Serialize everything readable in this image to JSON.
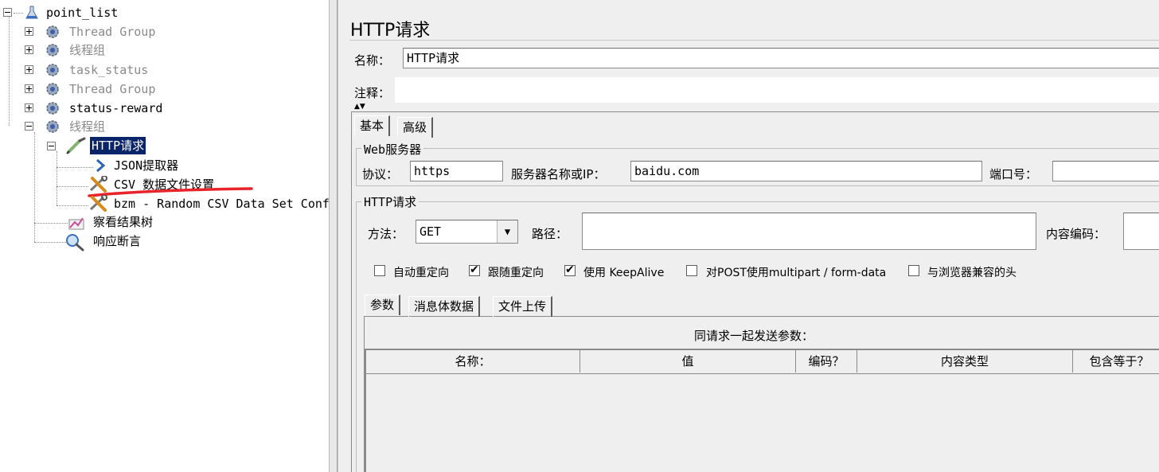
{
  "tree": {
    "root": "point_list",
    "groups": [
      {
        "label": "Thread Group",
        "enabled": false
      },
      {
        "label": "线程组",
        "enabled": false
      },
      {
        "label": "task_status",
        "enabled": false
      },
      {
        "label": "Thread Group",
        "enabled": false
      },
      {
        "label": "status-reward",
        "enabled": true
      },
      {
        "label": "线程组",
        "enabled": false
      }
    ],
    "sampler": "HTTP请求",
    "children": [
      {
        "label": "JSON提取器",
        "icon": "arrow-icon"
      },
      {
        "label": "CSV 数据文件设置",
        "icon": "tools-icon"
      },
      {
        "label": "bzm - Random CSV Data Set Config",
        "icon": "tools-icon"
      }
    ],
    "listeners": [
      {
        "label": "察看结果树",
        "icon": "graph-icon"
      },
      {
        "label": "响应断言",
        "icon": "magnifier-icon"
      }
    ]
  },
  "panel": {
    "title": "HTTP请求",
    "name_label": "名称：",
    "name_value": "HTTP请求",
    "comment_label": "注释：",
    "comment_value": "",
    "tabs": [
      "基本",
      "高级"
    ],
    "web_server": {
      "legend": "Web服务器",
      "protocol_label": "协议：",
      "protocol_value": "https",
      "server_label": "服务器名称或IP：",
      "server_value": "baidu.com",
      "port_label": "端口号：",
      "port_value": ""
    },
    "http_request": {
      "legend": "HTTP请求",
      "method_label": "方法：",
      "method_value": "GET",
      "path_label": "路径：",
      "path_value": "",
      "encoding_label": "内容编码：",
      "encoding_value": ""
    },
    "options": [
      {
        "label": "自动重定向",
        "checked": false
      },
      {
        "label": "跟随重定向",
        "checked": true
      },
      {
        "label": "使用 KeepAlive",
        "checked": true
      },
      {
        "label": "对POST使用multipart / form-data",
        "checked": false
      },
      {
        "label": "与浏览器兼容的头",
        "checked": false
      }
    ],
    "param_tabs": [
      "参数",
      "消息体数据",
      "文件上传"
    ],
    "params_caption": "同请求一起发送参数：",
    "table_headers": [
      "名称：",
      "值",
      "编码？",
      "内容类型",
      "包含等于？"
    ]
  },
  "colors": {
    "selection": "#0a246a",
    "underline": "#e8232a"
  }
}
